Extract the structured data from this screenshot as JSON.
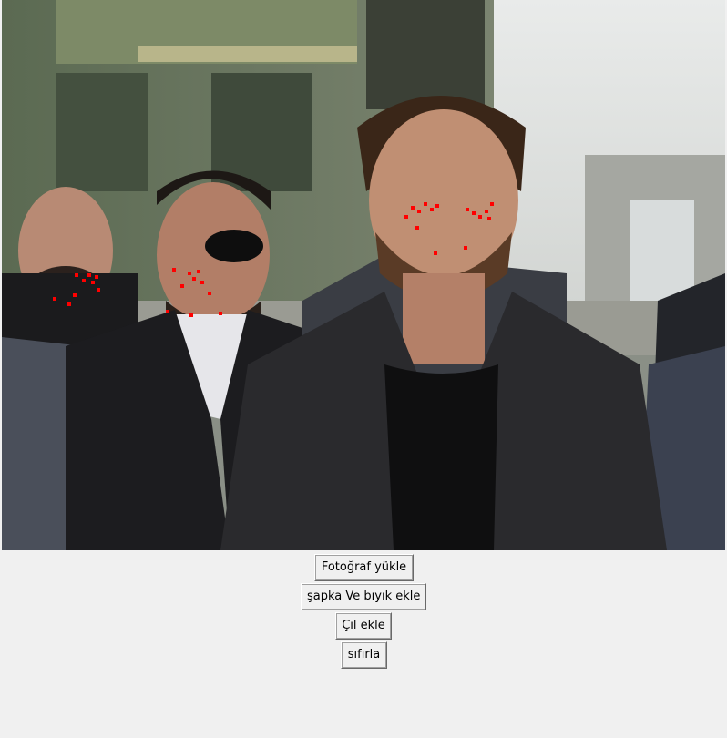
{
  "app": {
    "buttons": {
      "upload_photo": "Fotoğraf yükle",
      "add_hat_mustache": "şapka Ve bıyık ekle",
      "add_wrinkles": "Çıl ekle",
      "reset": "sıfırla"
    }
  },
  "colors": {
    "window_bg": "#f0f0f0",
    "landmark_dot": "#ff0000"
  },
  "image": {
    "description_icon": "photo-with-facial-landmarks"
  }
}
